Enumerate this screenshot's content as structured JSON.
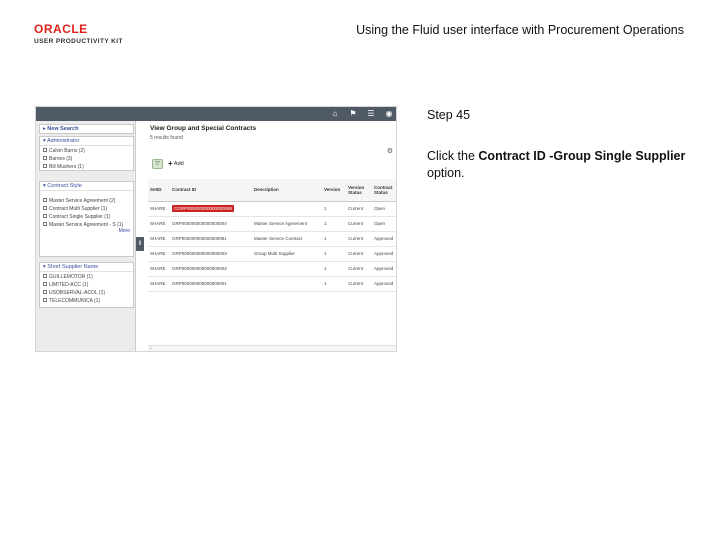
{
  "header": {
    "logo_brand": "ORACLE",
    "logo_subtitle": "USER PRODUCTIVITY KIT",
    "title": "Using the Fluid user interface with Procurement Operations"
  },
  "step": {
    "label": "Step 45",
    "instruction_prefix": "Click the ",
    "instruction_target": "Contract ID -Group Single Supplier",
    "instruction_suffix": " option."
  },
  "screenshot": {
    "topbar_icons": [
      "home-icon",
      "flag-icon",
      "menu-icon",
      "compass-icon"
    ],
    "left_panel": {
      "new_search": "New Search",
      "administrator": {
        "heading": "Administrator",
        "items": [
          "Calvin Barns (2)",
          "Barnes (3)",
          "Bill Mushers (1)"
        ]
      },
      "contract_style": {
        "heading": "Contract Style",
        "items": [
          "Master Service Agreement (2)",
          "Contract Multi Supplier (1)",
          "Contract Single Supplier (1)",
          "Master Service Agreement - S (1)"
        ],
        "more": "More"
      },
      "supplier_name": {
        "heading": "Short Supplier Name",
        "items": [
          "GUILLEMOTOR (1)",
          "LIMITED-ACC (1)",
          "USOBSERVAL-ACOL (1)",
          "TELECOMMUNICA (1)"
        ]
      }
    },
    "main": {
      "title": "View Group and Special Contracts",
      "count": "5 results found",
      "add_label": "Add",
      "columns": [
        "SetID",
        "Contract ID",
        "Description",
        "Version",
        "Version Status",
        "Contract Status"
      ],
      "rows": [
        [
          "SHARE",
          "CGRP000000000000000099",
          "",
          "1",
          "Current",
          "Open"
        ],
        [
          "SHARE",
          "GRP000000000000000004",
          "Master Service Agreement",
          "1",
          "Current",
          "Open"
        ],
        [
          "SHARE",
          "GRP000000000000000081",
          "Master Service Contract",
          "1",
          "Current",
          "Approved"
        ],
        [
          "SHARE",
          "GRP000000000000000003",
          "Group Multi Supplier",
          "1",
          "Current",
          "Approved"
        ],
        [
          "SHARE",
          "GRP000000000000000002",
          "",
          "1",
          "Current",
          "Approved"
        ],
        [
          "SHARE",
          "GRP000000000000000001",
          "",
          "1",
          "Current",
          "Approved"
        ]
      ]
    },
    "scroll_left": "‹"
  }
}
